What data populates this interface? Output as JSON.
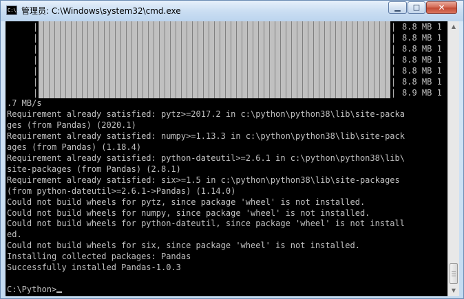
{
  "window": {
    "title": "管理员: C:\\Windows\\system32\\cmd.exe",
    "app_icon_text": "C:\\.",
    "minimize_symbol": "▁",
    "maximize_symbol": "□",
    "close_symbol": "✕"
  },
  "progress": {
    "pipe": "|",
    "rates": [
      "8.8 MB 1",
      "8.8 MB 1",
      "8.8 MB 1",
      "8.8 MB 1",
      "8.8 MB 1",
      "8.8 MB 1",
      "8.9 MB 1"
    ]
  },
  "console_lines": [
    ".7 MB/s",
    "Requirement already satisfied: pytz>=2017.2 in c:\\python\\python38\\lib\\site-packa",
    "ges (from Pandas) (2020.1)",
    "Requirement already satisfied: numpy>=1.13.3 in c:\\python\\python38\\lib\\site-pack",
    "ages (from Pandas) (1.18.4)",
    "Requirement already satisfied: python-dateutil>=2.6.1 in c:\\python\\python38\\lib\\",
    "site-packages (from Pandas) (2.8.1)",
    "Requirement already satisfied: six>=1.5 in c:\\python\\python38\\lib\\site-packages",
    "(from python-dateutil>=2.6.1->Pandas) (1.14.0)",
    "Could not build wheels for pytz, since package 'wheel' is not installed.",
    "Could not build wheels for numpy, since package 'wheel' is not installed.",
    "Could not build wheels for python-dateutil, since package 'wheel' is not install",
    "ed.",
    "Could not build wheels for six, since package 'wheel' is not installed.",
    "Installing collected packages: Pandas",
    "Successfully installed Pandas-1.0.3",
    "",
    "C:\\Python>"
  ],
  "scrollbar": {
    "up_arrow": "▲",
    "down_arrow": "▼"
  }
}
